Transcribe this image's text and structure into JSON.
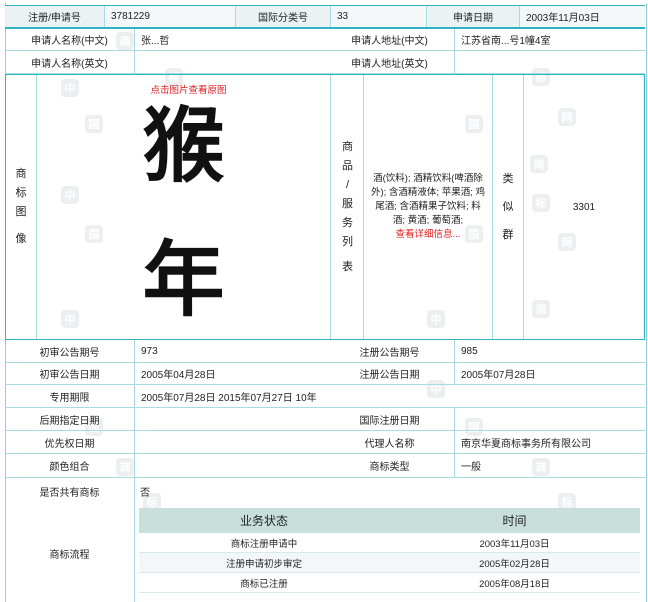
{
  "reg_number_label": "注册/申请号",
  "reg_number": "3781229",
  "intl_class_label": "国际分类号",
  "intl_class": "33",
  "apply_date_label": "申请日期",
  "apply_date": "2003年11月03日",
  "applicant_cn_label": "申请人名称(中文)",
  "applicant_cn": "张...哲",
  "address_cn_label": "申请人地址(中文)",
  "address_cn": "江苏省南...号1幢4室",
  "applicant_en_label": "申请人名称(英文)",
  "address_en_label": "申请人地址(英文)",
  "mark_image_label": [
    "商",
    "标",
    "图",
    "像"
  ],
  "click_view": "点击图片查看原图",
  "mark_chars": [
    "猴",
    "年"
  ],
  "goods_label": [
    "商",
    "品",
    "/",
    "服",
    "务",
    "列",
    "表"
  ],
  "goods_text": "酒(饮料); 酒精饮料(啤酒除外); 含酒精液体; 苹果酒; 鸡尾酒; 含酒精果子饮料; 料酒; 黄酒; 葡萄酒;",
  "goods_more": "查看详细信息...",
  "similar_label": [
    "类",
    "似",
    "群"
  ],
  "similar_group": "3301",
  "prelim_no_label": "初审公告期号",
  "prelim_no": "973",
  "reg_notice_no_label": "注册公告期号",
  "reg_notice_no": "985",
  "prelim_date_label": "初审公告日期",
  "prelim_date": "2005年04月28日",
  "reg_notice_date_label": "注册公告日期",
  "reg_notice_date": "2005年07月28日",
  "term_label": "专用期限",
  "term": "2005年07月28日 2015年07月27日 10年",
  "later_date_label": "后期指定日期",
  "intl_reg_date_label": "国际注册日期",
  "priority_date_label": "优先权日期",
  "agent_label": "代理人名称",
  "agent": "南京华夏商标事务所有限公司",
  "color_label": "颜色组合",
  "mark_type_label": "商标类型",
  "mark_type": "一般",
  "shared_label": "是否共有商标",
  "shared": "否",
  "flow_label": "商标流程",
  "flow_head": [
    "业务状态",
    "时间"
  ],
  "flow_rows": [
    {
      "status": "商标注册申请中",
      "time": "2003年11月03日"
    },
    {
      "status": "注册申请初步审定",
      "time": "2005年02月28日"
    },
    {
      "status": "商标已注册",
      "time": "2005年08月18日"
    }
  ],
  "watermarks": [
    "中",
    "国",
    "商",
    "标",
    "网"
  ],
  "colors": {
    "accent": "#2cb3c4",
    "border": "#a8dbe2",
    "flow_header": "#c8dfdc",
    "link": "#e02020"
  }
}
